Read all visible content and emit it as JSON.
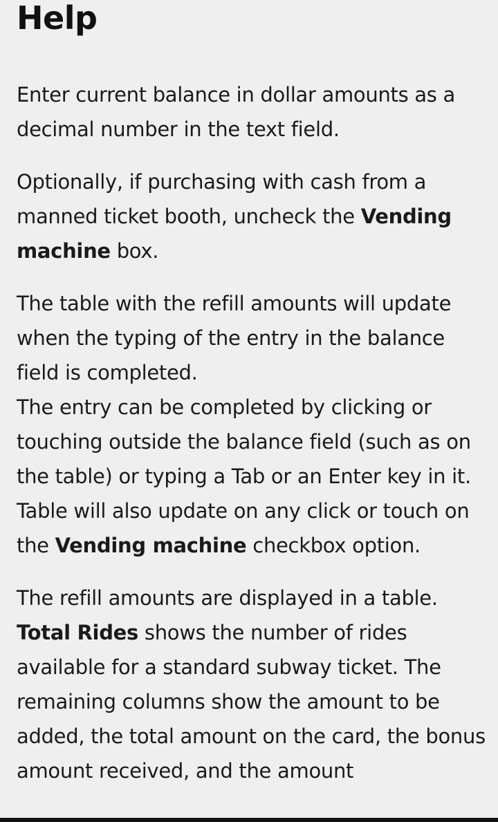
{
  "header": {
    "title": "Help"
  },
  "help": {
    "p1": "Enter current balance in dollar amounts as a decimal number in the text field.",
    "p2_start": "Optionally, if purchasing with cash from a manned ticket booth, uncheck the ",
    "p2_bold": "Vending machine",
    "p2_end": " box.",
    "p3_line1": "The table with the refill amounts will update when the typing of the entry in the balance field is completed.",
    "p3_line2": "The entry can be completed by clicking or touching outside the balance field (such as on the table) or typing a Tab or an Enter key in it.",
    "p3_line3_start": "Table will also update on any click or touch on the ",
    "p3_line3_bold": "Vending machine",
    "p3_line3_end": " checkbox option.",
    "p4_line1": "The refill amounts are displayed in a table.",
    "p4_bold": "Total Rides",
    "p4_rest": " shows the number of rides available for a standard subway ticket. The remaining columns show the amount to be added, the total amount on the card, the bonus amount received, and the amount"
  }
}
